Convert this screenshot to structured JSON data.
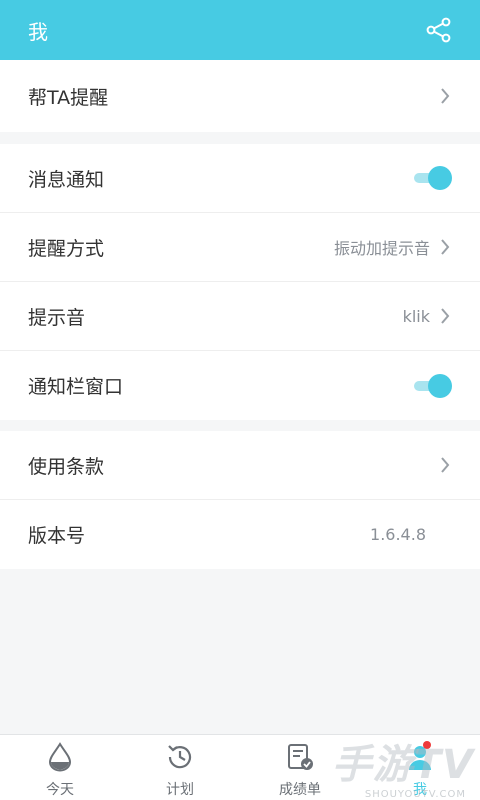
{
  "header": {
    "title": "我",
    "share_icon": "share-icon"
  },
  "group1": [
    {
      "label": "帮TA提醒",
      "type": "link"
    }
  ],
  "group2": [
    {
      "label": "消息通知",
      "type": "toggle",
      "on": true
    },
    {
      "label": "提醒方式",
      "type": "link",
      "value": "振动加提示音"
    },
    {
      "label": "提示音",
      "type": "link",
      "value": "klik"
    },
    {
      "label": "通知栏窗口",
      "type": "toggle",
      "on": true
    }
  ],
  "group3": [
    {
      "label": "使用条款",
      "type": "link"
    },
    {
      "label": "版本号",
      "type": "info",
      "value": "1.6.4.8"
    }
  ],
  "tabs": [
    {
      "label": "今天",
      "icon": "water-drop-icon",
      "active": false
    },
    {
      "label": "计划",
      "icon": "clock-history-icon",
      "active": false
    },
    {
      "label": "成绩单",
      "icon": "report-check-icon",
      "active": false
    },
    {
      "label": "我",
      "icon": "user-icon",
      "active": true,
      "badge": true
    }
  ],
  "watermark": {
    "text": "手游TV",
    "sub": "SHOUYOUTV.COM"
  },
  "colors": {
    "accent": "#47cbe3",
    "badge": "#ee3a3a"
  }
}
